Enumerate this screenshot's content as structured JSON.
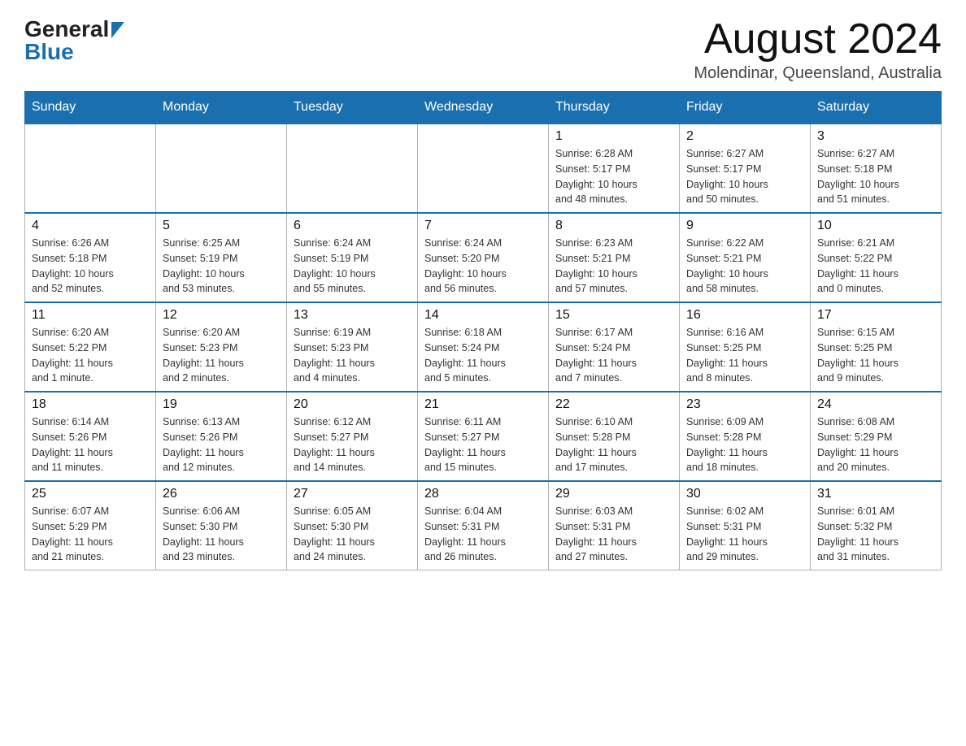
{
  "header": {
    "logo_general": "General",
    "logo_blue": "Blue",
    "title": "August 2024",
    "location": "Molendinar, Queensland, Australia"
  },
  "calendar": {
    "days_of_week": [
      "Sunday",
      "Monday",
      "Tuesday",
      "Wednesday",
      "Thursday",
      "Friday",
      "Saturday"
    ],
    "weeks": [
      {
        "days": [
          {
            "number": "",
            "info": ""
          },
          {
            "number": "",
            "info": ""
          },
          {
            "number": "",
            "info": ""
          },
          {
            "number": "",
            "info": ""
          },
          {
            "number": "1",
            "info": "Sunrise: 6:28 AM\nSunset: 5:17 PM\nDaylight: 10 hours\nand 48 minutes."
          },
          {
            "number": "2",
            "info": "Sunrise: 6:27 AM\nSunset: 5:17 PM\nDaylight: 10 hours\nand 50 minutes."
          },
          {
            "number": "3",
            "info": "Sunrise: 6:27 AM\nSunset: 5:18 PM\nDaylight: 10 hours\nand 51 minutes."
          }
        ]
      },
      {
        "days": [
          {
            "number": "4",
            "info": "Sunrise: 6:26 AM\nSunset: 5:18 PM\nDaylight: 10 hours\nand 52 minutes."
          },
          {
            "number": "5",
            "info": "Sunrise: 6:25 AM\nSunset: 5:19 PM\nDaylight: 10 hours\nand 53 minutes."
          },
          {
            "number": "6",
            "info": "Sunrise: 6:24 AM\nSunset: 5:19 PM\nDaylight: 10 hours\nand 55 minutes."
          },
          {
            "number": "7",
            "info": "Sunrise: 6:24 AM\nSunset: 5:20 PM\nDaylight: 10 hours\nand 56 minutes."
          },
          {
            "number": "8",
            "info": "Sunrise: 6:23 AM\nSunset: 5:21 PM\nDaylight: 10 hours\nand 57 minutes."
          },
          {
            "number": "9",
            "info": "Sunrise: 6:22 AM\nSunset: 5:21 PM\nDaylight: 10 hours\nand 58 minutes."
          },
          {
            "number": "10",
            "info": "Sunrise: 6:21 AM\nSunset: 5:22 PM\nDaylight: 11 hours\nand 0 minutes."
          }
        ]
      },
      {
        "days": [
          {
            "number": "11",
            "info": "Sunrise: 6:20 AM\nSunset: 5:22 PM\nDaylight: 11 hours\nand 1 minute."
          },
          {
            "number": "12",
            "info": "Sunrise: 6:20 AM\nSunset: 5:23 PM\nDaylight: 11 hours\nand 2 minutes."
          },
          {
            "number": "13",
            "info": "Sunrise: 6:19 AM\nSunset: 5:23 PM\nDaylight: 11 hours\nand 4 minutes."
          },
          {
            "number": "14",
            "info": "Sunrise: 6:18 AM\nSunset: 5:24 PM\nDaylight: 11 hours\nand 5 minutes."
          },
          {
            "number": "15",
            "info": "Sunrise: 6:17 AM\nSunset: 5:24 PM\nDaylight: 11 hours\nand 7 minutes."
          },
          {
            "number": "16",
            "info": "Sunrise: 6:16 AM\nSunset: 5:25 PM\nDaylight: 11 hours\nand 8 minutes."
          },
          {
            "number": "17",
            "info": "Sunrise: 6:15 AM\nSunset: 5:25 PM\nDaylight: 11 hours\nand 9 minutes."
          }
        ]
      },
      {
        "days": [
          {
            "number": "18",
            "info": "Sunrise: 6:14 AM\nSunset: 5:26 PM\nDaylight: 11 hours\nand 11 minutes."
          },
          {
            "number": "19",
            "info": "Sunrise: 6:13 AM\nSunset: 5:26 PM\nDaylight: 11 hours\nand 12 minutes."
          },
          {
            "number": "20",
            "info": "Sunrise: 6:12 AM\nSunset: 5:27 PM\nDaylight: 11 hours\nand 14 minutes."
          },
          {
            "number": "21",
            "info": "Sunrise: 6:11 AM\nSunset: 5:27 PM\nDaylight: 11 hours\nand 15 minutes."
          },
          {
            "number": "22",
            "info": "Sunrise: 6:10 AM\nSunset: 5:28 PM\nDaylight: 11 hours\nand 17 minutes."
          },
          {
            "number": "23",
            "info": "Sunrise: 6:09 AM\nSunset: 5:28 PM\nDaylight: 11 hours\nand 18 minutes."
          },
          {
            "number": "24",
            "info": "Sunrise: 6:08 AM\nSunset: 5:29 PM\nDaylight: 11 hours\nand 20 minutes."
          }
        ]
      },
      {
        "days": [
          {
            "number": "25",
            "info": "Sunrise: 6:07 AM\nSunset: 5:29 PM\nDaylight: 11 hours\nand 21 minutes."
          },
          {
            "number": "26",
            "info": "Sunrise: 6:06 AM\nSunset: 5:30 PM\nDaylight: 11 hours\nand 23 minutes."
          },
          {
            "number": "27",
            "info": "Sunrise: 6:05 AM\nSunset: 5:30 PM\nDaylight: 11 hours\nand 24 minutes."
          },
          {
            "number": "28",
            "info": "Sunrise: 6:04 AM\nSunset: 5:31 PM\nDaylight: 11 hours\nand 26 minutes."
          },
          {
            "number": "29",
            "info": "Sunrise: 6:03 AM\nSunset: 5:31 PM\nDaylight: 11 hours\nand 27 minutes."
          },
          {
            "number": "30",
            "info": "Sunrise: 6:02 AM\nSunset: 5:31 PM\nDaylight: 11 hours\nand 29 minutes."
          },
          {
            "number": "31",
            "info": "Sunrise: 6:01 AM\nSunset: 5:32 PM\nDaylight: 11 hours\nand 31 minutes."
          }
        ]
      }
    ]
  }
}
